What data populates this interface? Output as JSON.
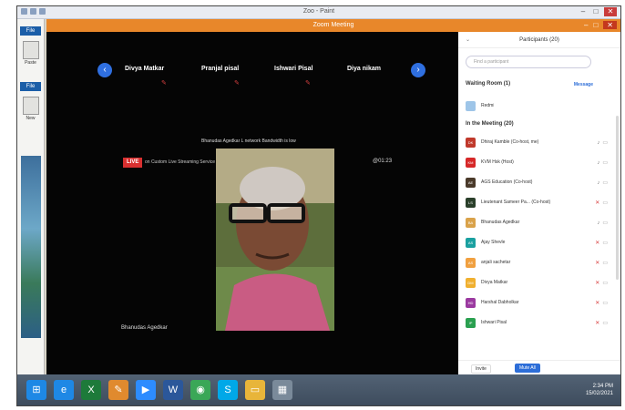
{
  "paint": {
    "window_title": "Zoo - Paint",
    "file_tab": "File",
    "paste_label": "Paste",
    "file_tab2": "File",
    "new_label": "New"
  },
  "zoom": {
    "window_title": "Zoom Meeting",
    "gallery": [
      {
        "name": "Divya Matkar"
      },
      {
        "name": "Pranjal pisal"
      },
      {
        "name": "Ishwari Pisal"
      },
      {
        "name": "Diya nikam"
      }
    ],
    "caption": "Bhanudas Agedkar L network Bandwidth is low",
    "live_badge": "LIVE",
    "live_text": "on Custom Live Streaming Service",
    "timer": "@01:23",
    "active_speaker": "Bhanudas Agedkar"
  },
  "participants_panel": {
    "title": "Participants (20)",
    "search_placeholder": "Find a participant",
    "waiting_header": "Waiting Room (1)",
    "waiting_action": "Message",
    "waiting": [
      {
        "name": "Redmi",
        "initials": "",
        "color": "#9ec5e8"
      }
    ],
    "meeting_header": "In the Meeting (20)",
    "members": [
      {
        "name": "Dhiraj Kamble (Co-host, me)",
        "initials": "DK",
        "color": "#c0392b",
        "mic": "mic-on-icon"
      },
      {
        "name": "KVM Hsk (Host)",
        "initials": "KM",
        "color": "#d62828",
        "mic": "mic-on-icon"
      },
      {
        "name": "AGS Education (Co-host)",
        "initials": "AE",
        "color": "#4a3a2a",
        "mic": "mic-on-icon"
      },
      {
        "name": "Lieutenant Sameer Pa... (Co-host)",
        "initials": "LS",
        "color": "#2a3f2a",
        "mic": "mic-muted-icon"
      },
      {
        "name": "Bhanudas Agedkar",
        "initials": "BA",
        "color": "#d9a24a",
        "mic": "mic-on-icon"
      },
      {
        "name": "Ajay Shevle",
        "initials": "AS",
        "color": "#1aa0a0",
        "mic": "mic-muted-icon"
      },
      {
        "name": "anjali sachetar",
        "initials": "AS",
        "color": "#f0a040",
        "mic": "mic-muted-icon"
      },
      {
        "name": "Divya Matkar",
        "initials": "DM",
        "color": "#f0b030",
        "mic": "mic-muted-icon"
      },
      {
        "name": "Harshal Dabholkar",
        "initials": "HD",
        "color": "#9b3aa0",
        "mic": "mic-muted-icon"
      },
      {
        "name": "Ishwari Pisal",
        "initials": "IP",
        "color": "#2aa050",
        "mic": "mic-muted-icon"
      }
    ],
    "invite_label": "Invite",
    "mute_all_label": "Mute All"
  },
  "taskbar": {
    "items": [
      {
        "icon": "windows-start-icon",
        "glyph": "⊞",
        "color": "#1e88e5"
      },
      {
        "icon": "internet-explorer-icon",
        "glyph": "e",
        "color": "#1e88e5"
      },
      {
        "icon": "excel-icon",
        "glyph": "X",
        "color": "#1d7a3a"
      },
      {
        "icon": "paint-icon",
        "glyph": "✎",
        "color": "#e08a2e"
      },
      {
        "icon": "zoom-icon",
        "glyph": "▶",
        "color": "#2d8cff"
      },
      {
        "icon": "word-icon",
        "glyph": "W",
        "color": "#2b579a"
      },
      {
        "icon": "chrome-icon",
        "glyph": "◉",
        "color": "#3aa757"
      },
      {
        "icon": "skype-icon",
        "glyph": "S",
        "color": "#00a8e8"
      },
      {
        "icon": "file-explorer-icon",
        "glyph": "▭",
        "color": "#e8b53a"
      },
      {
        "icon": "app-icon",
        "glyph": "▦",
        "color": "#7a8a9a"
      }
    ],
    "time": "2:34 PM",
    "date": "15/02/2021"
  }
}
